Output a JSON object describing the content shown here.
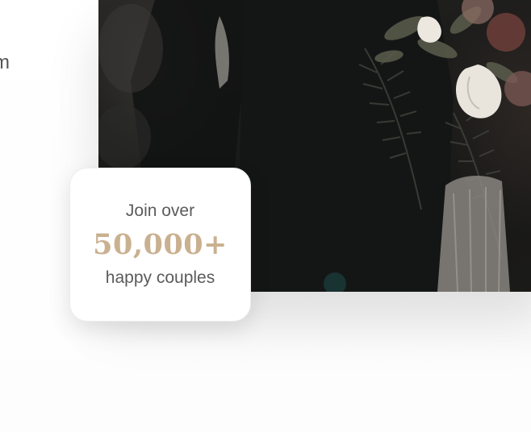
{
  "left_text": {
    "fragment": "m"
  },
  "hero_image": {
    "alt": "Wedding couple with bouquet"
  },
  "stats_card": {
    "prefix": "Join over",
    "number": "50,000+",
    "suffix": "happy couples",
    "accent_color": "#c9b08f"
  }
}
